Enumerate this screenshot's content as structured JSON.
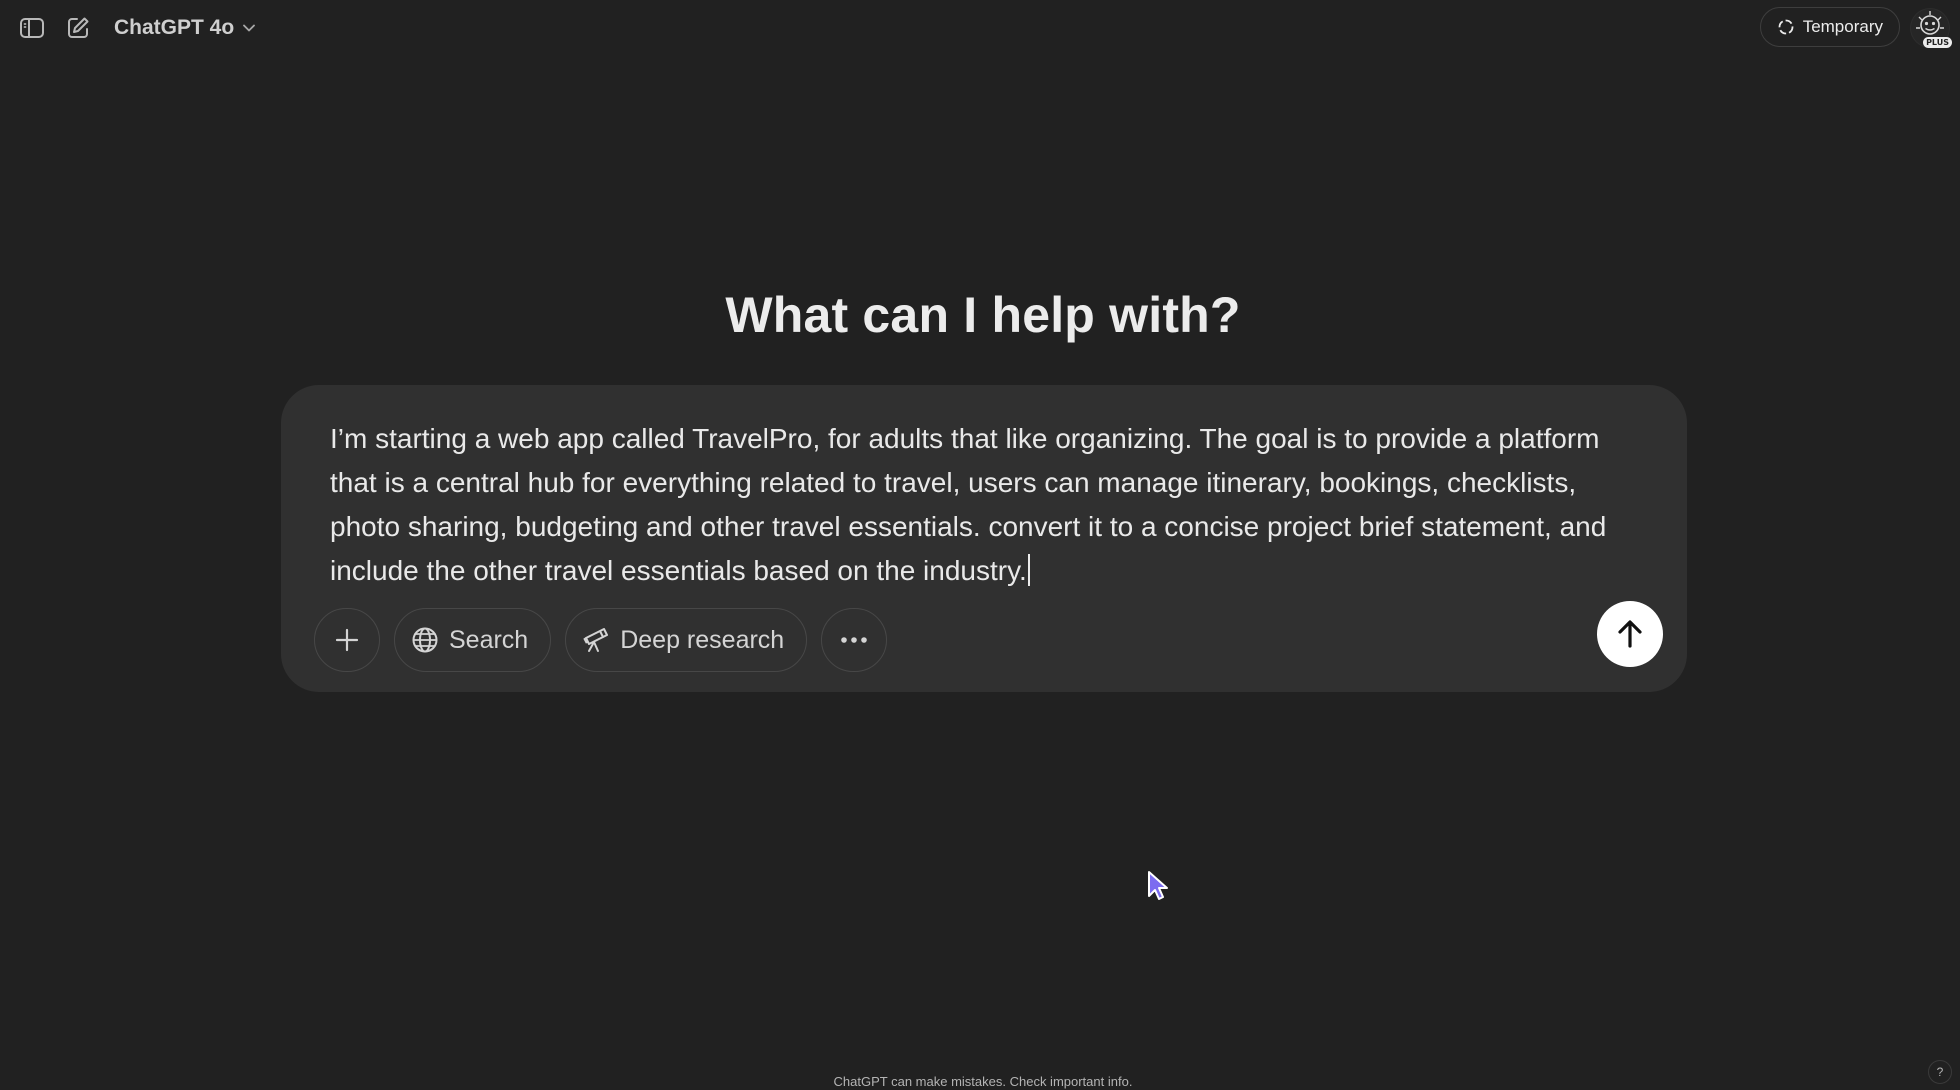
{
  "header": {
    "model_name": "ChatGPT 4o",
    "temporary_label": "Temporary",
    "avatar_badge": "PLUS"
  },
  "main": {
    "headline": "What can I help with?",
    "prompt": "I’m starting a web app called TravelPro, for adults that like organizing. The goal is to provide a platform that is a central hub for everything related to travel, users can manage itinerary, bookings, checklists, photo sharing, budgeting and other travel essentials. convert it to a concise project brief statement, and include the other travel essentials based on the industry."
  },
  "toolbar": {
    "search_label": "Search",
    "deep_research_label": "Deep research"
  },
  "footer": {
    "disclaimer": "ChatGPT can make mistakes. Check important info.",
    "help_label": "?"
  },
  "icons": {
    "sidebar": "sidebar-toggle-icon",
    "new_chat": "pencil-square-icon",
    "model_caret": "chevron-down-icon",
    "temporary": "dashed-circle-icon",
    "add": "plus-icon",
    "search": "globe-icon",
    "deep_research": "telescope-icon",
    "more": "ellipsis-icon",
    "send": "arrow-up-icon"
  },
  "colors": {
    "background": "#212121",
    "composer": "#303030",
    "send_button": "#ffffff",
    "cursor": "#7c6cf0"
  }
}
